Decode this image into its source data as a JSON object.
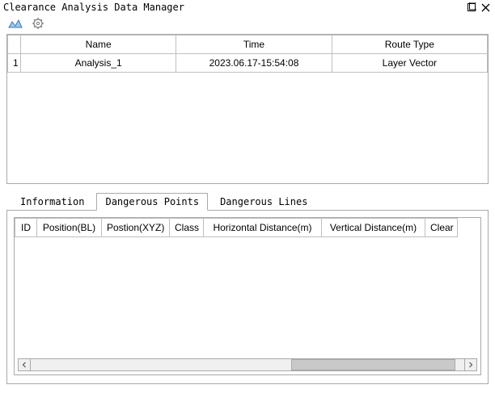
{
  "window": {
    "title": "Clearance Analysis Data Manager"
  },
  "icons": {
    "analysis": "analysis-icon",
    "settings": "gear-icon",
    "detach": "detach-icon",
    "close": "close-icon"
  },
  "upperTable": {
    "headers": {
      "rownum": "",
      "name": "Name",
      "time": "Time",
      "routeType": "Route Type"
    },
    "rows": [
      {
        "rownum": "1",
        "name": "Analysis_1",
        "time": "2023.06.17-15:54:08",
        "routeType": "Layer Vector"
      }
    ]
  },
  "tabs": {
    "items": [
      {
        "label": "Information",
        "active": false
      },
      {
        "label": "Dangerous Points",
        "active": true
      },
      {
        "label": "Dangerous Lines",
        "active": false
      }
    ]
  },
  "lowerTable": {
    "headers": {
      "id": "ID",
      "posBL": "Position(BL)",
      "posXYZ": "Postion(XYZ)",
      "cls": "Class",
      "hdist": "Horizontal Distance(m)",
      "vdist": "Vertical Distance(m)",
      "clear": "Clear"
    }
  }
}
